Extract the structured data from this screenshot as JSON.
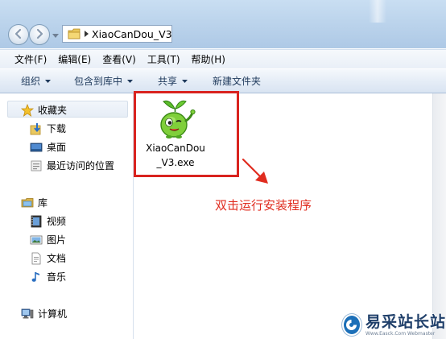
{
  "address_bar": {
    "current_folder": "XiaoCanDou_V3",
    "folder_icon": "folder-icon",
    "separator_icon": "chevron-right-icon"
  },
  "navigation": {
    "back_icon": "back-arrow-icon",
    "forward_icon": "forward-arrow-icon",
    "recent_icon": "chevron-down-icon"
  },
  "menu": {
    "items": [
      "文件(F)",
      "编辑(E)",
      "查看(V)",
      "工具(T)",
      "帮助(H)"
    ]
  },
  "toolbar": {
    "organize": "组织",
    "include_in_library": "包含到库中",
    "share": "共享",
    "new_folder": "新建文件夹"
  },
  "sidebar": {
    "favorites_header": "收藏夹",
    "favorites": [
      "下载",
      "桌面",
      "最近访问的位置"
    ],
    "libraries_header": "库",
    "libraries": [
      "视频",
      "图片",
      "文档",
      "音乐"
    ],
    "computer": "计算机"
  },
  "content": {
    "file": {
      "name": "XiaoCanDou_V3.exe",
      "icon": "green-bean-mascot-icon"
    },
    "annotation": "双击运行安装程序"
  },
  "watermark": {
    "title": "易采站长站",
    "subtitle": "Www.Easck.Com Webmaster"
  },
  "colors": {
    "highlight_red": "#d9231f",
    "annotation_text": "#e02c1f",
    "toolbar_text": "#1e395b",
    "titlebar_blue": "#bcd4ec"
  }
}
